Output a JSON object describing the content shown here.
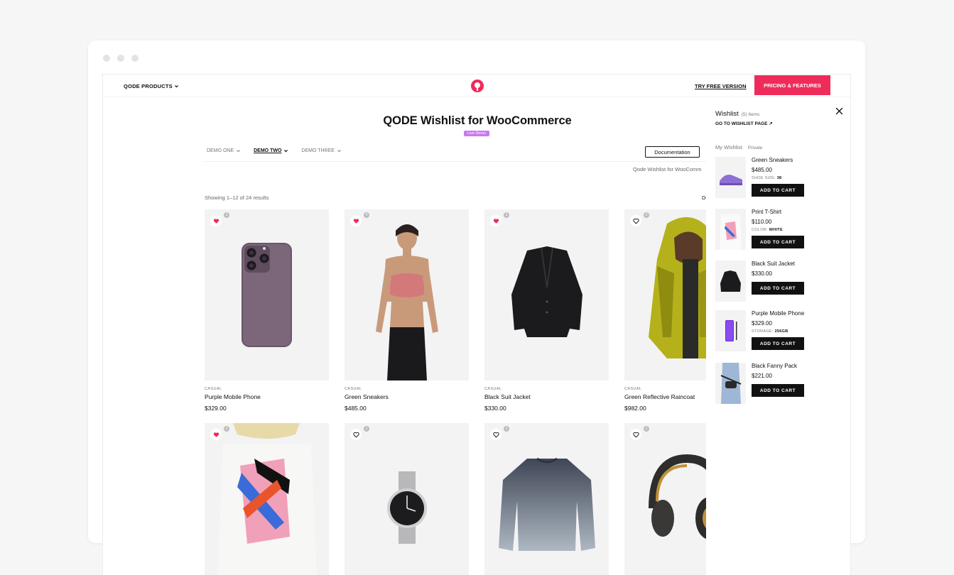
{
  "topbar": {
    "products_label": "QODE PRODUCTS",
    "try_free": "TRY FREE VERSION",
    "pricing": "PRICING & FEATURES"
  },
  "page": {
    "title": "QODE Wishlist for WooCommerce",
    "badge": "Live Demo",
    "tabs": [
      "DEMO ONE",
      "DEMO TWO",
      "DEMO THREE"
    ],
    "active_tab": "DEMO TWO",
    "documentation": "Documentation",
    "sub_text": "Qode Wishlist for WooComm",
    "results": "Showing 1–12 of 24 results",
    "sort_fragment": "De"
  },
  "products": [
    {
      "category": "CASUAL",
      "name": "Purple Mobile Phone",
      "price": "$329.00",
      "wish_count": "3",
      "wishlisted": true
    },
    {
      "category": "CASUAL",
      "name": "Green Sneakers",
      "price": "$485.00",
      "wish_count": "4",
      "wishlisted": true
    },
    {
      "category": "CASUAL",
      "name": "Black Suit Jacket",
      "price": "$330.00",
      "wish_count": "3",
      "wishlisted": true
    },
    {
      "category": "CASUAL",
      "name": "Green Reflective Raincoat",
      "price": "$982.00",
      "wish_count": "2",
      "wishlisted": false
    },
    {
      "wish_count": "2",
      "wishlisted": true
    },
    {
      "wish_count": "1",
      "wishlisted": false
    },
    {
      "wish_count": "1",
      "wishlisted": false
    },
    {
      "wish_count": "1",
      "wishlisted": false
    }
  ],
  "wishlist_panel": {
    "title": "Wishlist",
    "count": "(5) Items",
    "go_link": "GO TO WISHLIST PAGE ↗",
    "list_name": "My Wishlist",
    "privacy": "Private",
    "add_to_cart": "ADD TO CART",
    "items": [
      {
        "name": "Green Sneakers",
        "price": "$485.00",
        "attr_label": "SHOE SIZE:",
        "attr_value": "38"
      },
      {
        "name": "Print T-Shirt",
        "price": "$110.00",
        "attr_label": "COLOR:",
        "attr_value": "WHITE"
      },
      {
        "name": "Black Suit Jacket",
        "price": "$330.00",
        "attr_label": "",
        "attr_value": ""
      },
      {
        "name": "Purple Mobile Phone",
        "price": "$329.00",
        "attr_label": "STORAGE:",
        "attr_value": "256GB"
      },
      {
        "name": "Black Fanny Pack",
        "price": "$221.00",
        "attr_label": "",
        "attr_value": ""
      }
    ]
  },
  "colors": {
    "accent": "#ef2b5a",
    "badge": "#c779f1",
    "card_bg": "#f3f3f4"
  }
}
